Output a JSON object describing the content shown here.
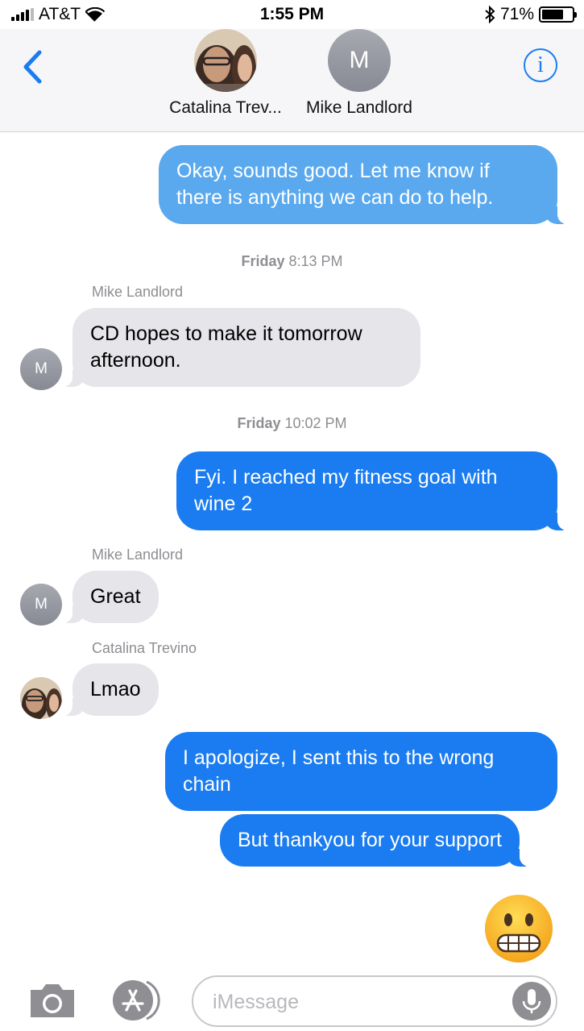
{
  "status_bar": {
    "carrier": "AT&T",
    "time": "1:55 PM",
    "battery": "71%",
    "battery_level": 0.71
  },
  "header": {
    "contacts": [
      {
        "name": "Catalina Trev...",
        "avatar": "photo"
      },
      {
        "name": "Mike Landlord",
        "avatar_initial": "M"
      }
    ],
    "back_icon": "chevron-left-icon",
    "info_icon": "info-icon",
    "info_glyph": "i"
  },
  "messages": {
    "m1": {
      "text": "Okay, sounds good. Let me know if there is anything we can do to help."
    },
    "ts1": {
      "day": "Friday",
      "time": "8:13 PM"
    },
    "sender1": "Mike Landlord",
    "m2": {
      "text": "CD hopes to make it tomorrow afternoon.",
      "avatar_initial": "M"
    },
    "ts2": {
      "day": "Friday",
      "time": "10:02 PM"
    },
    "m3": {
      "text": "Fyi. I reached my fitness goal with wine 2"
    },
    "sender2": "Mike Landlord",
    "m4": {
      "text": "Great",
      "avatar_initial": "M"
    },
    "sender3": "Catalina Trevino",
    "m5": {
      "text": "Lmao"
    },
    "m6": {
      "text": "I apologize, I sent this to the wrong chain"
    },
    "m7": {
      "text": "But thankyou for your support"
    },
    "m8": {
      "emoji": "grimacing-face"
    }
  },
  "input_bar": {
    "placeholder": "iMessage",
    "icons": [
      "camera-icon",
      "app-store-icon",
      "microphone-icon"
    ]
  },
  "colors": {
    "blue": "#1a7cf0",
    "blue_light": "#5aa9ef",
    "gray_bubble": "#e5e5ea",
    "header_bg": "#f6f6f8"
  }
}
